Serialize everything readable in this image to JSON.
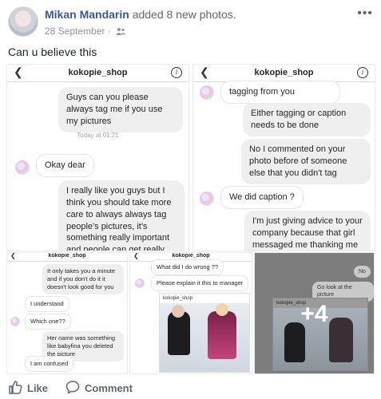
{
  "post": {
    "author": "Mikan Mandarin",
    "action": "added 8 new photos.",
    "date": "28 September",
    "separator": "·",
    "more": "•••",
    "caption": "Can u believe this"
  },
  "screenshot1": {
    "username": "kokopie_shop",
    "messages": [
      "Guys can you please always tag me if you use my pictures",
      "Okay dear",
      "I really like you guys but I think you should take more care to always always tag people's pictures, it's something really important and people can get really upset over it, if someone goes out of their way to take a"
    ],
    "timestamp": "Today at 01:21"
  },
  "screenshot2": {
    "username": "kokopie_shop",
    "messages": [
      "tagging from you",
      "Either tagging or caption needs to be done",
      "No I commented on your photo before of someone else that you didn't tag",
      "We did caption ?",
      "I'm just giving advice to your company because that girl messaged me thanking me for asking you to tag her"
    ]
  },
  "screenshot3": {
    "username": "kokopie_shop",
    "messages": [
      "It only takes you a minute and if you don't do it it doesn't look good for you",
      "I understand",
      "Which one??",
      "Her name was something like babyfina you deleted the picture",
      "I am confused"
    ]
  },
  "screenshot4": {
    "username": "kokopie_shop",
    "messages": [
      "What did I do wrong ??",
      "Please explain it this to manager"
    ],
    "post_user": "kokopie_shop"
  },
  "screenshot5": {
    "messages": [
      "No",
      "Go look at the picture"
    ],
    "post_user": "kokopie_shop",
    "more_count": "+4"
  },
  "actions": {
    "like": "Like",
    "comment": "Comment"
  },
  "colors": {
    "link": "#385898",
    "meta": "#90949c",
    "action_text": "#606770"
  }
}
